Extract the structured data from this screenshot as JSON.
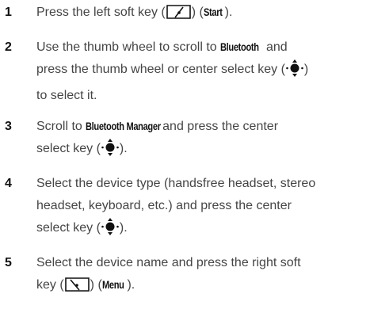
{
  "steps": [
    {
      "number": "1",
      "parts": [
        "Press the left soft key (",
        ") (",
        ")."
      ],
      "keywords": [
        "Start"
      ],
      "icons": [
        "left-soft-key-icon"
      ]
    },
    {
      "number": "2",
      "parts": [
        "Use the thumb wheel to scroll to ",
        " and",
        "press the thumb wheel or center select key (",
        ")",
        "to select it."
      ],
      "keywords": [
        "Bluetooth"
      ],
      "icons": [
        "center-select-key-icon"
      ]
    },
    {
      "number": "3",
      "parts": [
        "Scroll to ",
        " and press the center",
        "select key (",
        ")."
      ],
      "keywords": [
        "Bluetooth Manager"
      ],
      "icons": [
        "center-select-key-icon"
      ]
    },
    {
      "number": "4",
      "parts": [
        "Select the device type (handsfree headset, stereo",
        "headset, keyboard, etc.) and press the center",
        "select key (",
        ")."
      ],
      "icons": [
        "center-select-key-icon"
      ]
    },
    {
      "number": "5",
      "parts": [
        "Select the device name and press the right soft",
        "key (",
        ") (",
        ")."
      ],
      "keywords": [
        "Menu"
      ],
      "icons": [
        "right-soft-key-icon"
      ]
    }
  ]
}
